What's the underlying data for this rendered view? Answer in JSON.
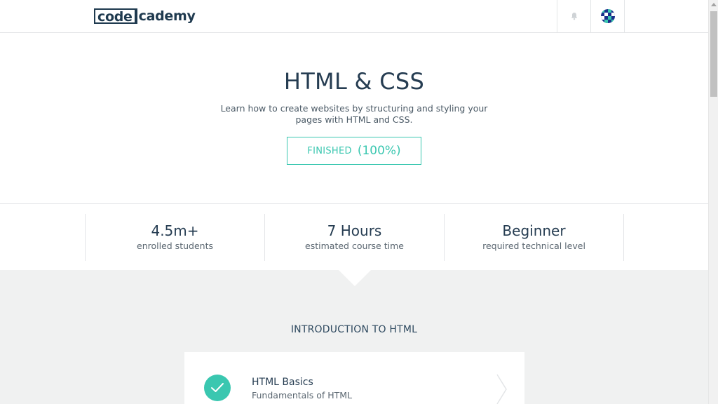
{
  "brand": {
    "logo_code": "code",
    "logo_cademy": "cademy"
  },
  "nav": {
    "bell_icon": "bell-icon",
    "avatar_icon": "avatar-icon"
  },
  "course": {
    "title": "HTML & CSS",
    "description": "Learn how to create websites by structuring and styling your pages with HTML and CSS.",
    "status_label": "FINISHED",
    "status_percent": "(100%)",
    "progress": 1.0
  },
  "stats": [
    {
      "value": "4.5m+",
      "label": "enrolled students"
    },
    {
      "value": "7 Hours",
      "label": "estimated course time"
    },
    {
      "value": "Beginner",
      "label": "required technical level"
    }
  ],
  "section": {
    "title": "INTRODUCTION TO HTML",
    "lessons": [
      {
        "title": "HTML Basics",
        "subtitle": "Fundamentals of HTML",
        "completed": true
      }
    ]
  },
  "colors": {
    "accent": "#3ac7b0",
    "text_dark": "#263d52",
    "background_grey": "#f0f1f1"
  }
}
